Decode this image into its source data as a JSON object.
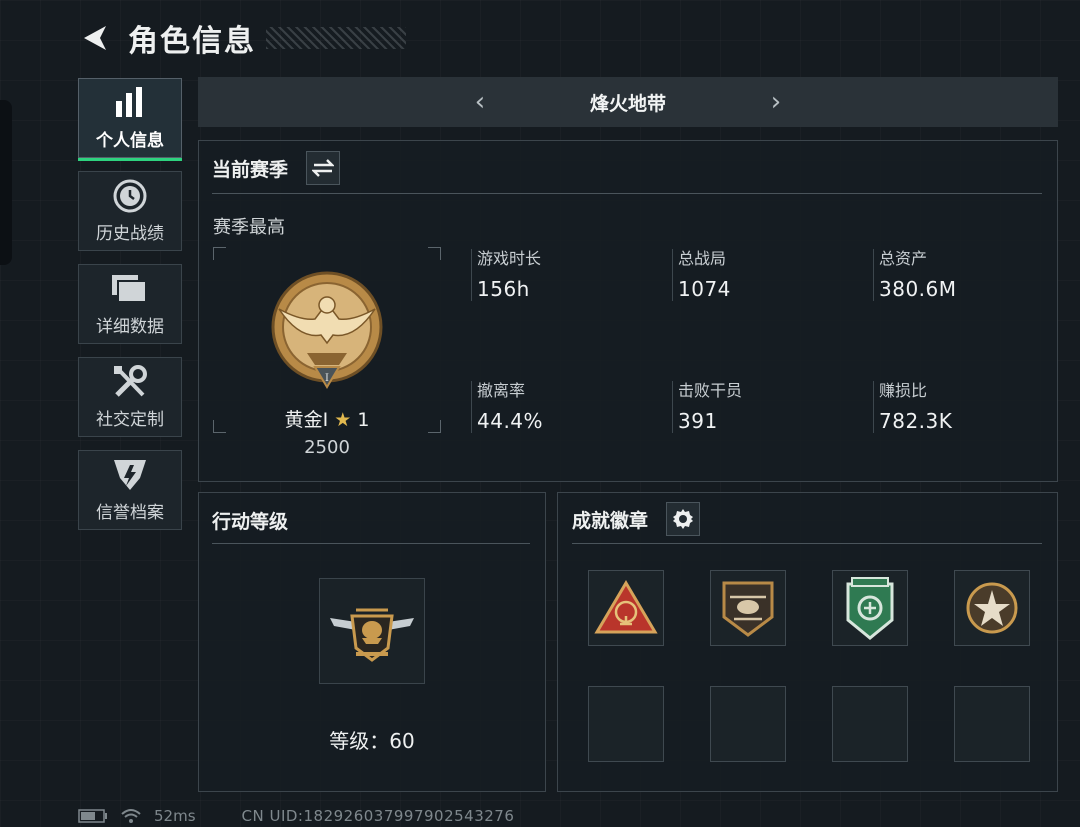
{
  "header": {
    "title": "角色信息"
  },
  "sidebar": {
    "items": [
      {
        "label": "个人信息",
        "icon": "bar-chart-icon"
      },
      {
        "label": "历史战绩",
        "icon": "history-clock-icon"
      },
      {
        "label": "详细数据",
        "icon": "folders-icon"
      },
      {
        "label": "社交定制",
        "icon": "tools-icon"
      },
      {
        "label": "信誉档案",
        "icon": "shield-emblem-icon"
      }
    ],
    "active_index": 0
  },
  "mode": {
    "title": "烽火地带"
  },
  "season": {
    "title": "当前赛季",
    "sub_label": "赛季最高",
    "rank_name": "黄金Ⅰ",
    "rank_stars": "1",
    "rank_score": "2500",
    "stats": [
      {
        "label": "游戏时长",
        "value": "156h"
      },
      {
        "label": "总战局",
        "value": "1074"
      },
      {
        "label": "总资产",
        "value": "380.6M"
      },
      {
        "label": "撤离率",
        "value": "44.4%"
      },
      {
        "label": "击败干员",
        "value": "391"
      },
      {
        "label": "赚损比",
        "value": "782.3K"
      }
    ]
  },
  "action_level": {
    "title": "行动等级",
    "level_text": "等级：60"
  },
  "achievements": {
    "title": "成就徽章",
    "badges": [
      "triangle-badge-icon",
      "helicopter-badge-icon",
      "green-shield-badge-icon",
      "star-badge-icon"
    ]
  },
  "footer": {
    "ping": "52ms",
    "uid": "CN UID:1829260379979025432​76"
  },
  "colors": {
    "accent": "#2ed37f",
    "gold": "#c99a4e",
    "background": "#151b20"
  }
}
